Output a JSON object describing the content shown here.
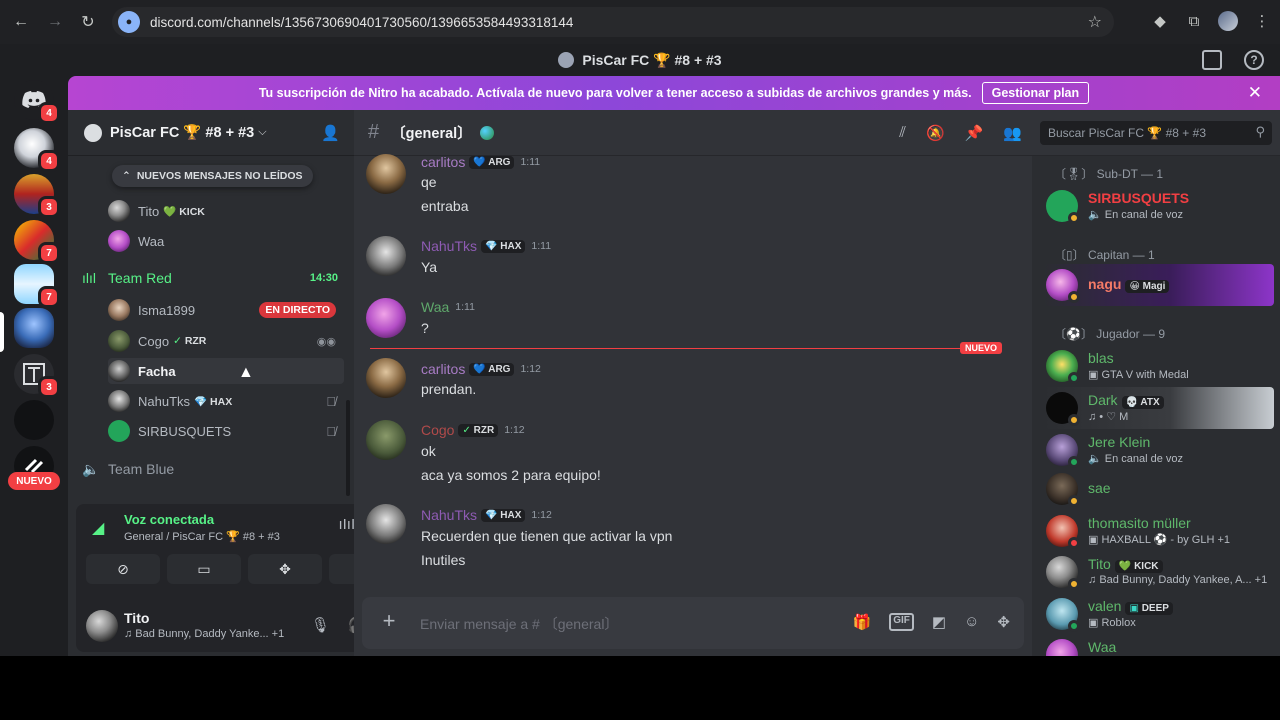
{
  "browser": {
    "url": "discord.com/channels/1356730690401730560/1396653584493318144"
  },
  "title_bar": {
    "title": "PisCar FC 🏆 #8 + #3"
  },
  "server_rail": {
    "badges": [
      "4",
      "4",
      "3",
      "7",
      "7",
      "3"
    ],
    "new_label": "NUEVO"
  },
  "nitro": {
    "text": "Tu suscripción de Nitro ha acabado. Actívala de nuevo para volver a tener acceso a subidas de archivos grandes y más.",
    "button": "Gestionar plan"
  },
  "sidebar": {
    "server_name": "PisCar FC 🏆 #8 + #3",
    "new_unread": "NUEVOS MENSAJES NO LEÍDOS",
    "top_users": [
      {
        "name": "Tito",
        "tag": "KICK"
      },
      {
        "name": "Waa",
        "tag": ""
      }
    ],
    "team_red": {
      "name": "Team Red",
      "time": "14:30"
    },
    "red_users": [
      {
        "name": "Isma1899",
        "tag": "",
        "live": "EN DIRECTO"
      },
      {
        "name": "Cogo",
        "tag": "RZR"
      },
      {
        "name": "Facha",
        "tag": ""
      },
      {
        "name": "NahuTks",
        "tag": "HAX"
      },
      {
        "name": "SIRBUSQUETS",
        "tag": ""
      }
    ],
    "team_blue": {
      "name": "Team Blue"
    }
  },
  "voice_panel": {
    "status": "Voz conectada",
    "location": "General / PisCar FC 🏆 #8 + #3"
  },
  "user_panel": {
    "name": "Tito",
    "activity": "♫ Bad Bunny, Daddy Yanke...  +1"
  },
  "chat": {
    "channel_name": "〔general〕",
    "new_label": "NUEVO",
    "messages": [
      {
        "author": "carlitos",
        "tag": "ARG",
        "time": "1:11",
        "lines": [
          "qe",
          "entraba"
        ]
      },
      {
        "author": "NahuTks",
        "tag": "HAX",
        "time": "1:11",
        "lines": [
          "Ya"
        ]
      },
      {
        "author": "Waa",
        "tag": "",
        "time": "1:11",
        "lines": [
          "?"
        ]
      },
      {
        "author": "carlitos",
        "tag": "ARG",
        "time": "1:12",
        "lines": [
          "prendan."
        ]
      },
      {
        "author": "Cogo",
        "tag": "RZR",
        "time": "1:12",
        "lines": [
          "ok",
          "aca ya somos 2 para equipo!"
        ]
      },
      {
        "author": "NahuTks",
        "tag": "HAX",
        "time": "1:12",
        "lines": [
          "Recuerden que tienen que activar la vpn",
          "Inutiles"
        ]
      }
    ],
    "composer_placeholder": "Enviar mensaje a # 〔general〕"
  },
  "members": {
    "search_placeholder": "Buscar PisCar FC 🏆 #8 + #3",
    "roles": [
      {
        "label": "Sub-DT — 1"
      },
      {
        "label": "Capitan — 1"
      },
      {
        "label": "Jugador — 9"
      }
    ],
    "list": [
      {
        "name": "SIRBUSQUETS",
        "sub": "En canal de voz",
        "tag": ""
      },
      {
        "name": "nagu",
        "sub": "",
        "tag": "Magi"
      },
      {
        "name": "blas",
        "sub": "GTA V with Medal",
        "tag": ""
      },
      {
        "name": "Dark",
        "sub": "♫ • ♡ M",
        "tag": "ATX"
      },
      {
        "name": "Jere Klein",
        "sub": "En canal de voz",
        "tag": ""
      },
      {
        "name": "sae",
        "sub": "",
        "tag": ""
      },
      {
        "name": "thomasito müller",
        "sub": "HAXBALL ⚽ - by GLH  +1",
        "tag": ""
      },
      {
        "name": "Tito",
        "sub": "Bad Bunny, Daddy Yankee, A...  +1",
        "tag": "KICK"
      },
      {
        "name": "valen",
        "sub": "Roblox",
        "tag": "DEEP"
      },
      {
        "name": "Waa",
        "sub": "",
        "tag": ""
      }
    ]
  },
  "colors": {
    "online": "#23a55a",
    "idle": "#f0b232",
    "dnd": "#f23f43",
    "live": "#da373c",
    "voice_green": "#57f287",
    "nitro_purple": "#9b47d6"
  }
}
